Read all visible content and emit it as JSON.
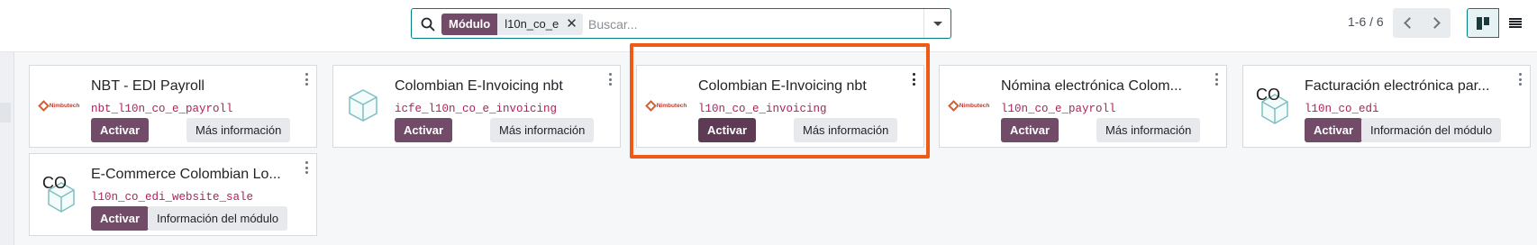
{
  "search": {
    "facet_name": "Módulo",
    "facet_value": "l10n_co_e",
    "placeholder": "Buscar..."
  },
  "pager": {
    "value": "1-6 / 6"
  },
  "colors": {
    "primary": "#714b67",
    "accent": "#017e84",
    "technical_name": "#b0205b",
    "highlight": "#f05a17"
  },
  "modules": [
    {
      "title": "NBT - EDI Payroll",
      "technical": "nbt_l10n_co_e_payroll",
      "activate": "Activar",
      "info": "Más información",
      "logo": "nimbutech-logo",
      "logo_text": "Nimbutech"
    },
    {
      "title": "Colombian E-Invoicing nbt",
      "technical": "icfe_l10n_co_e_invoicing",
      "activate": "Activar",
      "info": "Más información",
      "logo": "cube-icon"
    },
    {
      "title": "Colombian E-Invoicing nbt",
      "technical": "l10n_co_e_invoicing",
      "activate": "Activar",
      "info": "Más información",
      "logo": "nimbutech-logo",
      "logo_text": "Nimbutech",
      "highlighted": true
    },
    {
      "title": "Nómina electrónica Colom...",
      "technical": "l10n_co_e_payroll",
      "activate": "Activar",
      "info": "Más información",
      "logo": "nimbutech-logo",
      "logo_text": "Nimbutech"
    },
    {
      "title": "Facturación electrónica par...",
      "technical": "l10n_co_edi",
      "activate": "Activar",
      "info": "Información del módulo",
      "logo": "co-cube-icon",
      "logo_text": "CO"
    },
    {
      "title": "E-Commerce Colombian Lo...",
      "technical": "l10n_co_edi_website_sale",
      "activate": "Activar",
      "info": "Información del módulo",
      "logo": "co-cube-icon",
      "logo_text": "CO"
    }
  ]
}
